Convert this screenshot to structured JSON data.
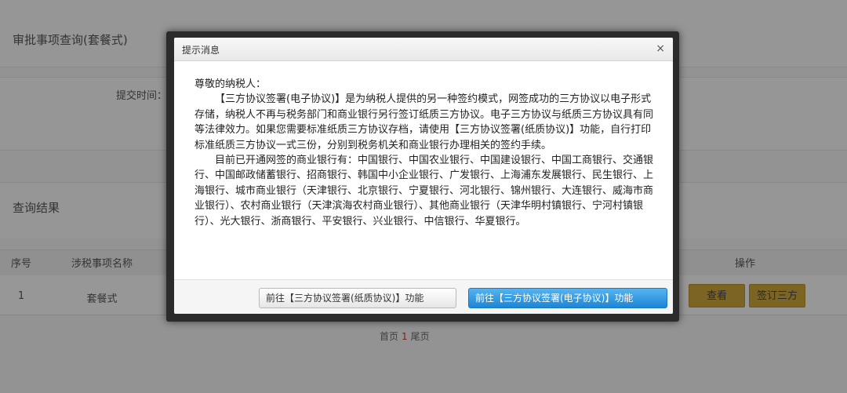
{
  "background": {
    "page_title": "审批事项查询(套餐式)",
    "submit_time_label": "提交时间：",
    "results_title": "查询结果",
    "table": {
      "headers": {
        "index": "序号",
        "name": "涉税事项名称",
        "actions": "操作"
      },
      "rows": [
        {
          "index": "1",
          "name": "套餐式",
          "view_label": "查看",
          "sign_label": "签订三方"
        }
      ]
    },
    "pager": {
      "first": "首页",
      "current": "1",
      "last": "尾页"
    }
  },
  "dialog": {
    "title": "提示消息",
    "close_symbol": "×",
    "greeting": "尊敬的纳税人：",
    "paragraph1": "【三方协议签署(电子协议)】是为纳税人提供的另一种签约模式，网签成功的三方协议以电子形式存储，纳税人不再与税务部门和商业银行另行签订纸质三方协议。电子三方协议与纸质三方协议具有同等法律效力。如果您需要标准纸质三方协议存档，请使用【三方协议签署(纸质协议)】功能，自行打印标准纸质三方协议一式三份，分别到税务机关和商业银行办理相关的签约手续。",
    "paragraph2": "目前已开通网签的商业银行有：中国银行、中国农业银行、中国建设银行、中国工商银行、交通银行、中国邮政储蓄银行、招商银行、韩国中小企业银行、广发银行、上海浦东发展银行、民生银行、上海银行、城市商业银行（天津银行、北京银行、宁夏银行、河北银行、锦州银行、大连银行、威海市商业银行）、农村商业银行（天津滨海农村商业银行）、其他商业银行（天津华明村镇银行、宁河村镇银行）、光大银行、浙商银行、平安银行、兴业银行、中信银行、华夏银行。",
    "paper_button": "前往【三方协议签署(纸质协议)】功能",
    "electronic_button": "前往【三方协议签署(电子协议)】功能"
  },
  "colors": {
    "primary": "#1c86d6",
    "bg_button": "#c9a23c"
  }
}
